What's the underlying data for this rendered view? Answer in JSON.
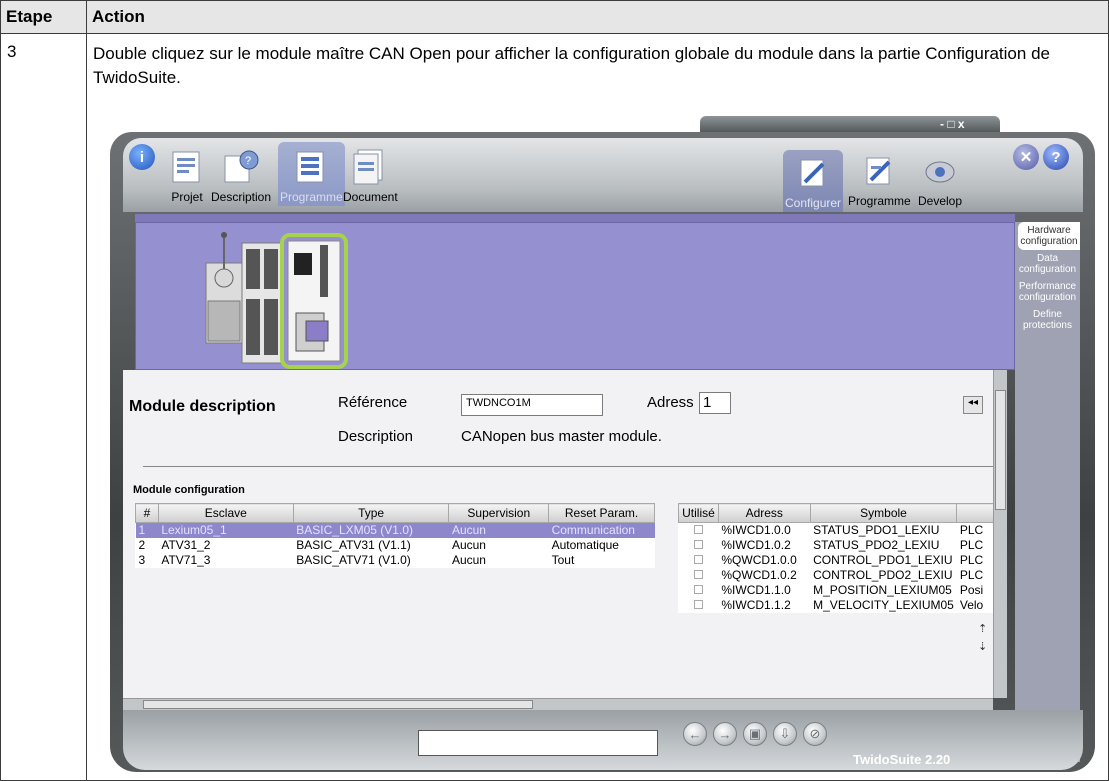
{
  "doc": {
    "header_step": "Etape",
    "header_action": "Action",
    "step_number": "3",
    "instruction": "Double cliquez sur le module maître CAN Open pour afficher la configuration globale du module dans la partie Configuration de TwidoSuite."
  },
  "app": {
    "nav_tabs": [
      "Projet",
      "Description",
      "Programme",
      "Document"
    ],
    "mode_tabs": [
      "Configurer",
      "Programme",
      "Develop"
    ],
    "window_controls": "- □ x",
    "side_menu": [
      {
        "label": "Hardware configuration",
        "active": true
      },
      {
        "label": "Data configuration",
        "active": false
      },
      {
        "label": "Performance configuration",
        "active": false
      },
      {
        "label": "Define protections",
        "active": false
      }
    ],
    "module_description": {
      "title": "Module description",
      "reference_label": "Référence",
      "reference_value": "TWDNCO1M",
      "adress_label": "Adress",
      "adress_value": "1",
      "description_label": "Description",
      "description_value": "CANopen bus master module."
    },
    "module_configuration": {
      "title": "Module configuration",
      "columns": [
        "#",
        "Esclave",
        "Type",
        "Supervision",
        "Reset Param."
      ],
      "rows": [
        {
          "num": "1",
          "esclave": "Lexium05_1",
          "type": "BASIC_LXM05 (V1.0)",
          "supervision": "Aucun",
          "reset": "Communication",
          "selected": true
        },
        {
          "num": "2",
          "esclave": "ATV31_2",
          "type": "BASIC_ATV31 (V1.1)",
          "supervision": "Aucun",
          "reset": "Automatique",
          "selected": false
        },
        {
          "num": "3",
          "esclave": "ATV71_3",
          "type": "BASIC_ATV71 (V1.0)",
          "supervision": "Aucun",
          "reset": "Tout",
          "selected": false
        }
      ]
    },
    "io_table": {
      "columns": [
        "Utilisé",
        "Adress",
        "Symbole",
        ""
      ],
      "rows": [
        {
          "adress": "%IWCD1.0.0",
          "symbole": "STATUS_PDO1_LEXIU",
          "extra": "PLC"
        },
        {
          "adress": "%IWCD1.0.2",
          "symbole": "STATUS_PDO2_LEXIU",
          "extra": "PLC"
        },
        {
          "adress": "%QWCD1.0.0",
          "symbole": "CONTROL_PDO1_LEXIU",
          "extra": "PLC"
        },
        {
          "adress": "%QWCD1.0.2",
          "symbole": "CONTROL_PDO2_LEXIU",
          "extra": "PLC"
        },
        {
          "adress": "%IWCD1.1.0",
          "symbole": "M_POSITION_LEXIUM05",
          "extra": "Posi"
        },
        {
          "adress": "%IWCD1.1.2",
          "symbole": "M_VELOCITY_LEXIUM05",
          "extra": "Velo"
        }
      ]
    },
    "bottom": {
      "version": "TwidoSuite 2.20"
    }
  },
  "colors": {
    "accent_purple": "#9590d0",
    "selected_row": "#8d87cc",
    "highlight_green": "#a7d24c"
  }
}
